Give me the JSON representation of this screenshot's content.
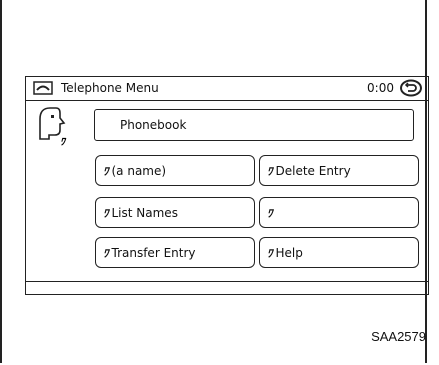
{
  "titlebar": {
    "title": "Telephone Menu",
    "time": "0:00",
    "phone_icon": "telephone-icon",
    "back_icon": "back-icon"
  },
  "voice_icon": "voice-recognition-icon",
  "phonebook": {
    "label": "Phonebook"
  },
  "buttons": [
    {
      "label": "(a name)",
      "icon": "voice-command-icon"
    },
    {
      "label": "Delete Entry",
      "icon": "voice-command-icon"
    },
    {
      "label": "List Names",
      "icon": "voice-command-icon"
    },
    {
      "label": "",
      "icon": "voice-command-icon"
    },
    {
      "label": "Transfer Entry",
      "icon": "voice-command-icon"
    },
    {
      "label": "Help",
      "icon": "voice-command-icon"
    }
  ],
  "voice_mark": "ﾜ",
  "figure_code": "SAA2579"
}
